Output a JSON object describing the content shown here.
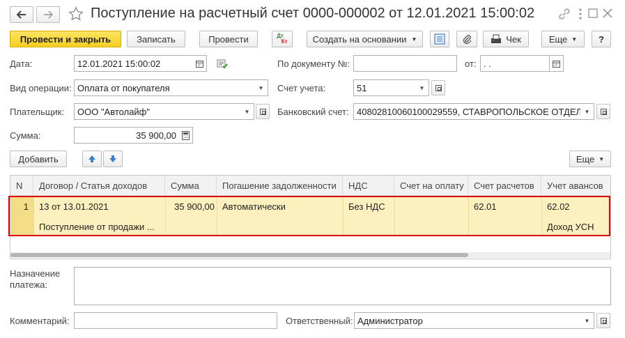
{
  "title": "Поступление на расчетный счет 0000-000002 от 12.01.2021 15:00:02",
  "toolbar": {
    "post_close": "Провести и закрыть",
    "save": "Записать",
    "post": "Провести",
    "dt_kt_top": "Дт",
    "dt_kt_bottom": "Кт",
    "create_based": "Создать на основании",
    "check": "Чек",
    "more": "Еще",
    "help": "?"
  },
  "form": {
    "date_label": "Дата:",
    "date_value": "12.01.2021 15:00:02",
    "doc_num_label": "По документу №:",
    "doc_num_value": "",
    "from_label": "от:",
    "from_value": " .  .",
    "operation_label": "Вид операции:",
    "operation_value": "Оплата от покупателя",
    "account_label": "Счет учета:",
    "account_value": "51",
    "payer_label": "Плательщик:",
    "payer_value": "ООО \"Автолайф\"",
    "bank_label": "Банковский счет:",
    "bank_value": "40802810060100029559, СТАВРОПОЛЬСКОЕ ОТДЕЛ",
    "sum_label": "Сумма:",
    "sum_value": "35 900,00"
  },
  "table_toolbar": {
    "add": "Добавить",
    "more": "Еще"
  },
  "table": {
    "headers": [
      "N",
      "Договор / Статья доходов",
      "Сумма",
      "Погашение задолженности",
      "НДС",
      "Счет на оплату",
      "Счет расчетов",
      "Учет авансов"
    ],
    "rows": [
      {
        "n": "1",
        "contract": "13 от 13.01.2021",
        "contract_line2": "Поступление от продажи ...",
        "sum": "35 900,00",
        "repayment": "Автоматически",
        "vat": "Без НДС",
        "invoice": "",
        "settlement_account": "62.01",
        "advance_account": "62.02",
        "advance_line2": "Доход УСН"
      }
    ]
  },
  "footer": {
    "purpose_label_1": "Назначение",
    "purpose_label_2": "платежа:",
    "purpose_value": "",
    "comment_label": "Комментарий:",
    "comment_value": "",
    "responsible_label": "Ответственный:",
    "responsible_value": "Администратор"
  },
  "colors": {
    "primary_button": "#f5cf22",
    "selected_row": "#fbf0be",
    "highlight_frame": "#e00000"
  }
}
